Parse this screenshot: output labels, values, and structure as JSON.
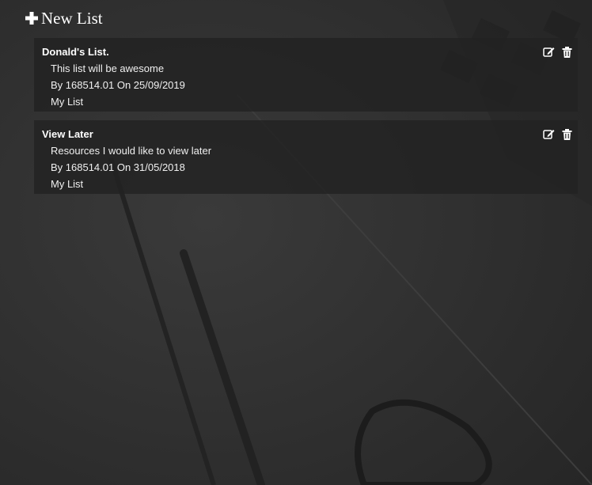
{
  "header": {
    "new_list_label": "New List"
  },
  "lists": [
    {
      "title": "Donald's List.",
      "description": "This list will be awesome",
      "byline": "By 168514.01 On 25/09/2019",
      "owner_label": "My List"
    },
    {
      "title": "View Later",
      "description": "Resources I would like to view later",
      "byline": "By 168514.01 On 31/05/2018",
      "owner_label": "My List"
    }
  ],
  "icons": {
    "add": "plus-icon",
    "edit": "edit-icon",
    "delete": "trash-icon"
  },
  "colors": {
    "card_background": "#222222",
    "text": "#ffffff"
  }
}
